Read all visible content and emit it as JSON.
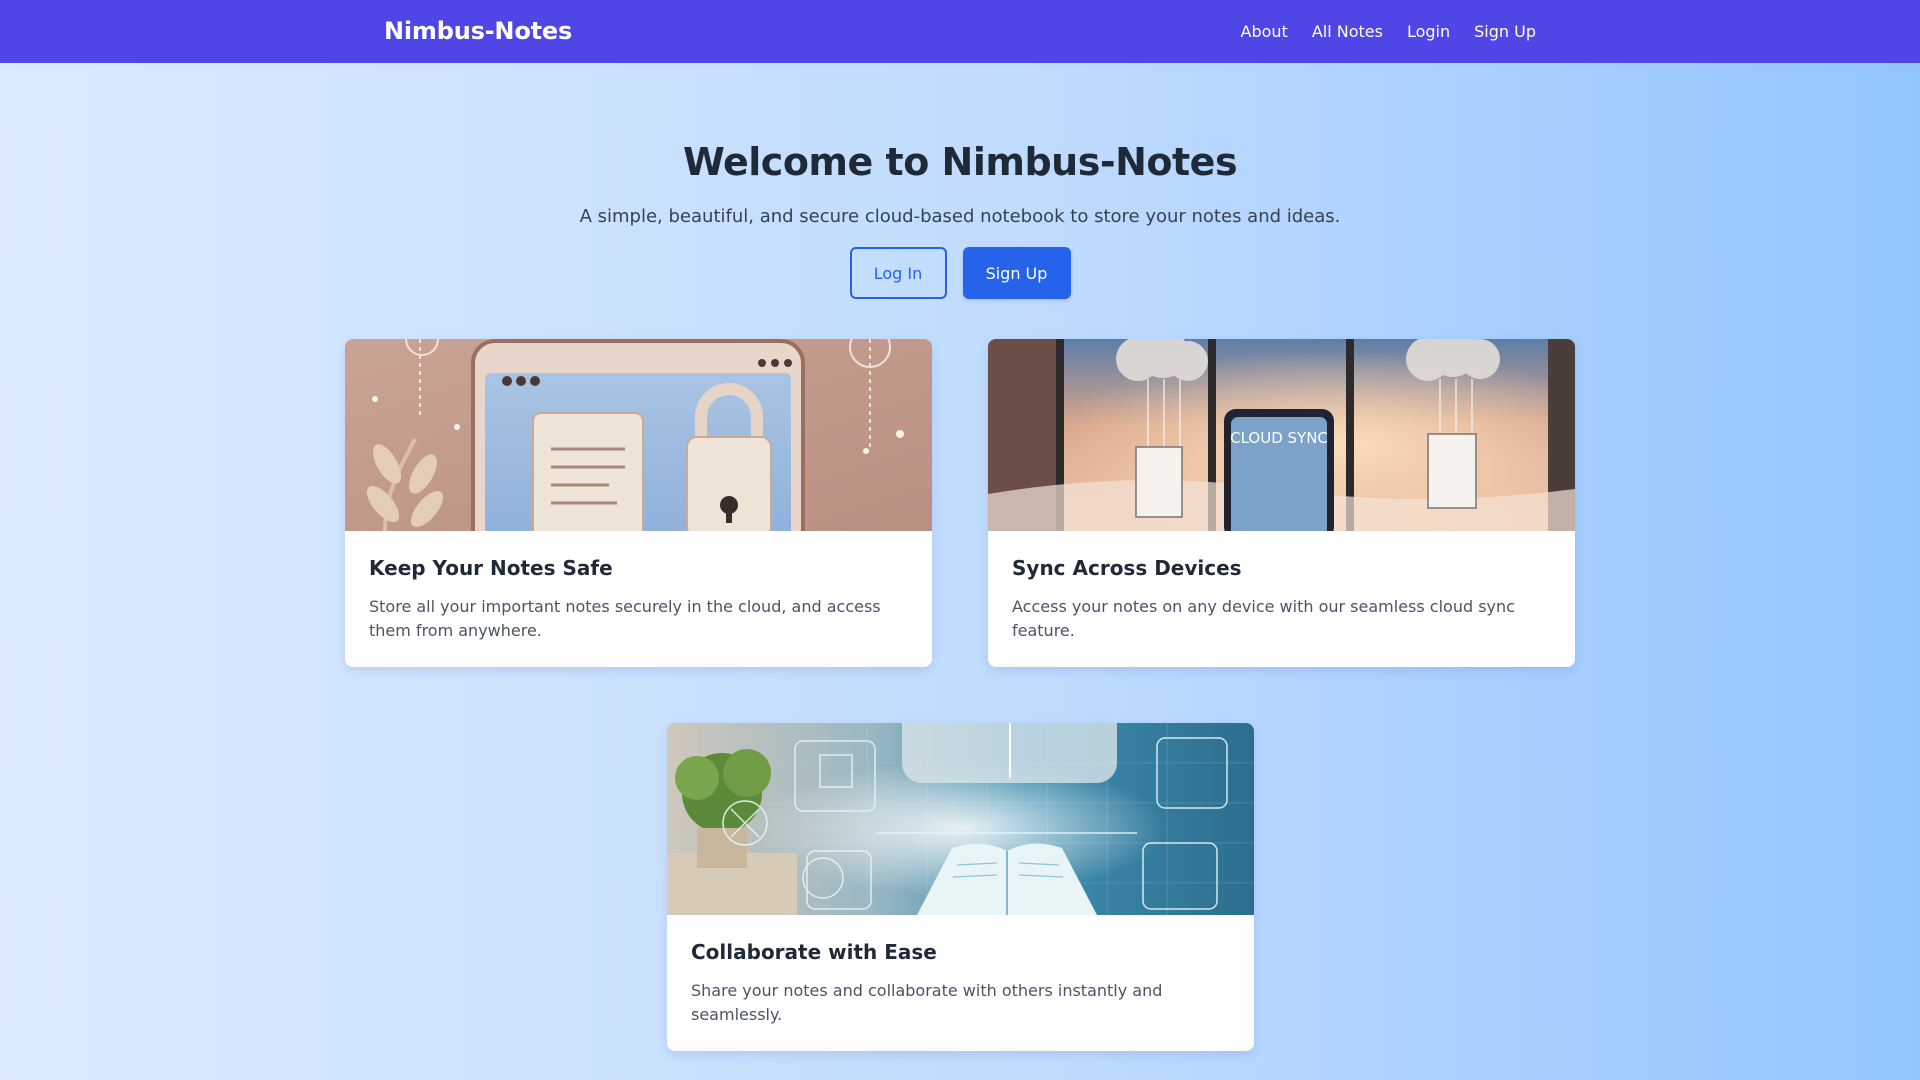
{
  "navbar": {
    "brand": "Nimbus-Notes",
    "links": [
      "About",
      "All Notes",
      "Login",
      "Sign Up"
    ]
  },
  "hero": {
    "title": "Welcome to Nimbus-Notes",
    "subtitle": "A simple, beautiful, and secure cloud-based notebook to store your notes and ideas.",
    "login_label": "Log In",
    "signup_label": "Sign Up"
  },
  "features": [
    {
      "title": "Keep Your Notes Safe",
      "text": "Store all your important notes securely in the cloud, and access them from anywhere."
    },
    {
      "title": "Sync Across Devices",
      "text": "Access your notes on any device with our seamless cloud sync feature.",
      "image_text": "CLOUD SYNC"
    },
    {
      "title": "Collaborate with Ease",
      "text": "Share your notes and collaborate with others instantly and seamlessly."
    }
  ],
  "colors": {
    "navbar": "#4f46e5",
    "primary_button": "#2563eb",
    "background_start": "#dbeafe",
    "background_end": "#93c5fd"
  },
  "icons": [
    "padlock-illustration",
    "cloud-sync-illustration",
    "collaboration-illustration"
  ]
}
